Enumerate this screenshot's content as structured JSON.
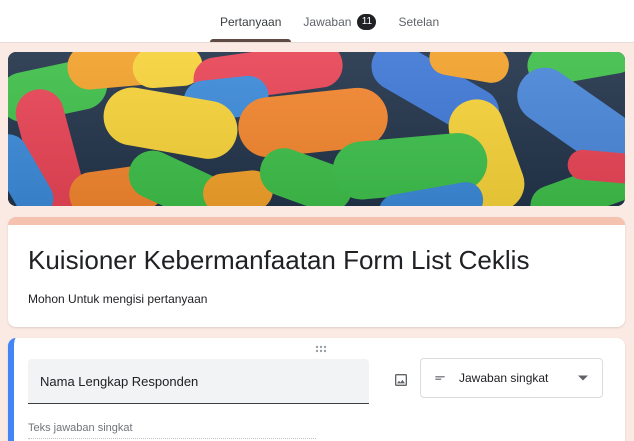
{
  "tabs": {
    "questions_label": "Pertanyaan",
    "responses_label": "Jawaban",
    "responses_count": "11",
    "settings_label": "Setelan"
  },
  "banner": {
    "description": "colorful capsule candies header image"
  },
  "form": {
    "title": "Kuisioner Kebermanfaatan Form List Ceklis",
    "description": "Mohon Untuk mengisi pertanyaan"
  },
  "question": {
    "text": "Nama Lengkap Responden",
    "type_label": "Jawaban singkat",
    "answer_placeholder": "Teks jawaban singkat"
  },
  "colors": {
    "theme_background": "#fbe9e3",
    "header_accent": "#f6c2b0",
    "active_question_accent": "#4285f4"
  },
  "icons": [
    "drag-handle-icon",
    "image-icon",
    "short-answer-icon",
    "dropdown-arrow-icon"
  ]
}
